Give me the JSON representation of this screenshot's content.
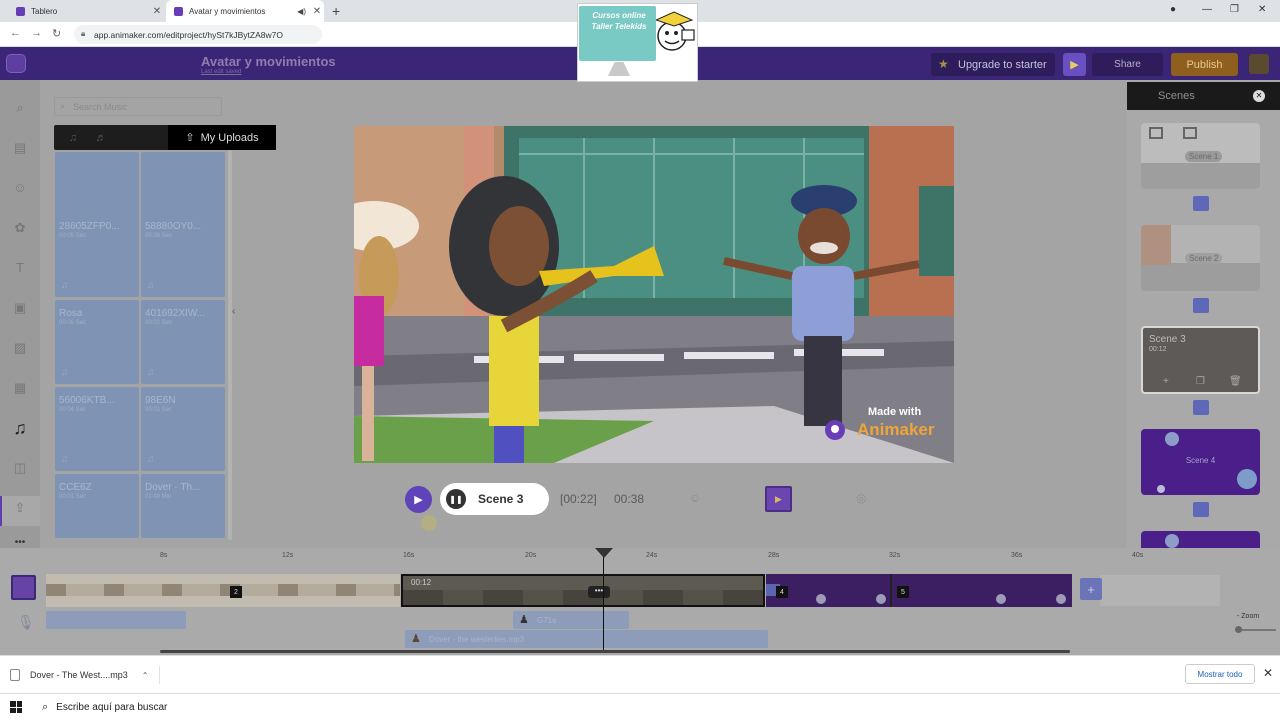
{
  "browser": {
    "tabs": [
      {
        "title": "Tablero"
      },
      {
        "title": "Avatar y movimientos"
      }
    ],
    "new_tab": "+",
    "url": "app.animaker.com/editproject/hySt7kJBytZA8w7O"
  },
  "watermark": {
    "text": "Cursos online Taller Telekids"
  },
  "app": {
    "project_title": "Avatar y movimientos",
    "saved_label": "Last edit saved",
    "upgrade_label": "Upgrade to starter",
    "share_label": "Share",
    "publish_label": "Publish"
  },
  "library": {
    "search_placeholder": "Search Music",
    "tab_active_label": "My Uploads",
    "tiles": [
      {
        "name": "",
        "duration": ""
      },
      {
        "name": "",
        "duration": ""
      },
      {
        "name": "28605ZFP0...",
        "duration": "00:05 Sec"
      },
      {
        "name": "58880OY0...",
        "duration": "00:08 Sec"
      },
      {
        "name": "Rosa",
        "duration": "00:06 Sec"
      },
      {
        "name": "401692XIW...",
        "duration": "00:02 Sec"
      },
      {
        "name": "56006KTB...",
        "duration": "00:04 Sec"
      },
      {
        "name": "98E6N",
        "duration": "00:01 Sec"
      },
      {
        "name": "CCE6Z",
        "duration": "00:01 Sec"
      },
      {
        "name": "Dover - Th...",
        "duration": "01:49 Min"
      }
    ]
  },
  "stage": {
    "made_with": "Made with",
    "brand": "Animaker"
  },
  "controls": {
    "scene_label": "Scene 3",
    "current_time": "[00:22]",
    "total_time": "00:38"
  },
  "scenes_panel": {
    "title": "Scenes",
    "scenes": [
      {
        "label": "Scene 1"
      },
      {
        "label": "Scene 2"
      },
      {
        "label": "Scene 3",
        "duration": "00:12"
      },
      {
        "label": "Scene 4"
      }
    ]
  },
  "timeline": {
    "ruler": [
      "8s",
      "12s",
      "16s",
      "20s",
      "24s",
      "28s",
      "32s",
      "36s",
      "40s"
    ],
    "scene_chips": [
      "2",
      "4",
      "5"
    ],
    "active_scene_time": "00:12",
    "audio_clip_1": "G71s",
    "audio_clip_2": "Dover - the westerlies.mp3",
    "zoom_label": "Zoom"
  },
  "download_bar": {
    "file_name": "Dover - The West....mp3",
    "show_all": "Mostrar todo"
  },
  "taskbar": {
    "search_placeholder": "Escribe aquí para buscar"
  }
}
